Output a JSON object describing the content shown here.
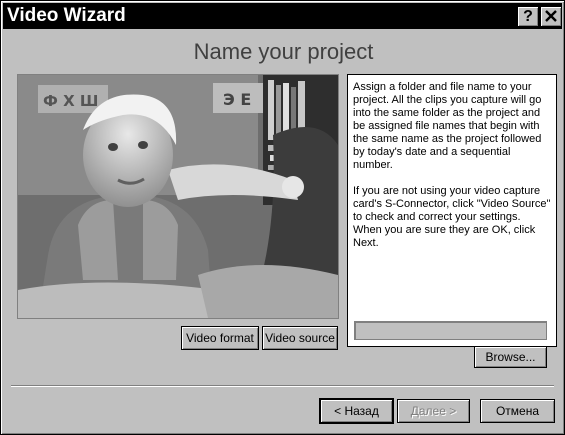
{
  "window": {
    "title": "Video Wizard",
    "help_button": "?",
    "close_button": "✕"
  },
  "page": {
    "heading": "Name your project"
  },
  "preview": {
    "video_format_label": "Video format",
    "video_source_label": "Video source"
  },
  "info": {
    "paragraph1": "Assign a folder and file name to your project. All the clips you capture will go into the same folder as the project and be assigned file names that begin with the same name as the project followed by today's date and a sequential number.",
    "paragraph2": "If you are not using your video capture card's S-Connector, click \"Video Source\" to check and correct your settings. When you are sure they are OK, click Next.",
    "path_value": "",
    "browse_label": "Browse..."
  },
  "footer": {
    "back_label": "< Назад",
    "next_label": "Далее >",
    "cancel_label": "Отмена"
  },
  "colors": {
    "titlebar": "#000000",
    "face": "#c0c0c0",
    "panel": "#ffffff"
  }
}
